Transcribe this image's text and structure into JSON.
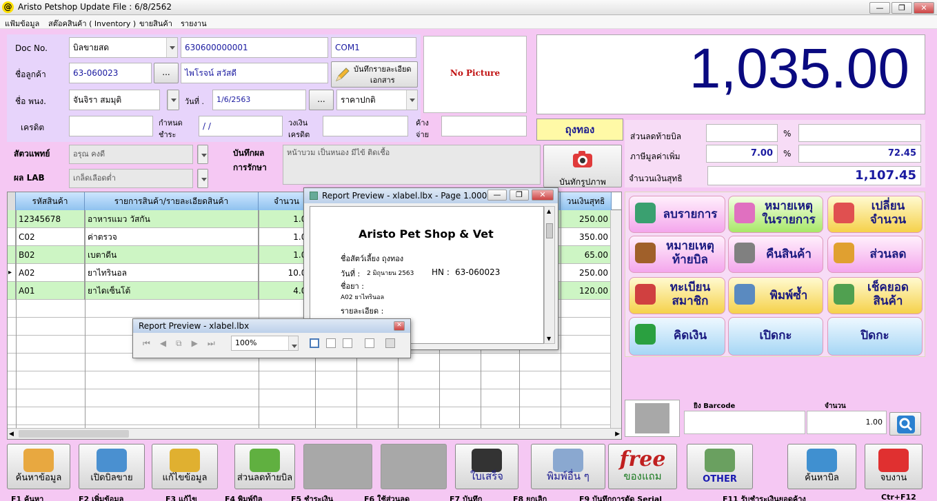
{
  "window": {
    "title": "Aristo Petshop  Update File : 6/8/2562",
    "logo": "@"
  },
  "menu": [
    "แฟ้มข้อมูล",
    "สต๊อคสินค้า ( Inventory )",
    "ขายสินค้า",
    "รายงาน"
  ],
  "form": {
    "doc_no_label": "Doc No.",
    "doc_type": "บิลขายสด",
    "doc_no": "630600000001",
    "com": "COM1",
    "customer_label": "ชื่อลูกค้า",
    "customer_code": "63-060023",
    "ellipsis": "...",
    "customer_name": "ไพโรจน์ สวัสดี",
    "save_doc_btn": [
      "บันทึกรายละเอียด",
      "เอกสาร"
    ],
    "staff_label": "ชื่อ พนง.",
    "staff": "จันจิรา สมมุติ",
    "date_label": "วันที่ .",
    "date": "1/6/2563",
    "price_type": "ราคาปกติ",
    "credit_label": "เครดิต",
    "due_label": [
      "กำหนด",
      "ชำระ"
    ],
    "due_value": "/ /",
    "limit_label": [
      "วงเงิน",
      "เครดิต"
    ],
    "owe_label": [
      "ค้าง",
      "จ่าย"
    ],
    "no_picture": "No Picture",
    "vet_label": "สัตวแพทย์",
    "vet": "อรุณ คงดี",
    "lab_label": "ผล LAB",
    "lab": "เกล็ดเลือดต่ำ",
    "treat_label": [
      "บันทึกผล",
      "การรักษา"
    ],
    "treat": "หน้าบวม เป็นหนอง มีไข้ ติดเชื้อ",
    "pet_name": "ถุงทอง",
    "photo_btn": "บันทักรูปภาพ"
  },
  "total": "1,035.00",
  "summary": {
    "discount_label": "ส่วนลดท้ายบิล",
    "percent": "%",
    "vat_label": "ภาษีมูลค่าเพิ่ม",
    "vat_rate": "7.00",
    "vat_amount": "72.45",
    "net_label": "จำนวนเงินสุทธิ",
    "net": "1,107.45"
  },
  "actions": [
    {
      "label": "ลบรายการ",
      "style": "ab-pink",
      "icon": "delete-item-icon",
      "color": "#3aa070"
    },
    {
      "label": "หมายเหตุ ในรายการ",
      "style": "ab-green",
      "icon": "comment-icon",
      "color": "#e070c0"
    },
    {
      "label": "เปลี่ยน จำนวน",
      "style": "ab-yellow",
      "icon": "swap-icon",
      "color": "#e05050"
    },
    {
      "label": "หมายเหตุ ท้ายบิล",
      "style": "ab-pink",
      "icon": "notebook-icon",
      "color": "#a0602a"
    },
    {
      "label": "คืนสินค้า",
      "style": "ab-pink",
      "icon": "return-icon",
      "color": "#808080"
    },
    {
      "label": "ส่วนลด",
      "style": "ab-pink",
      "icon": "discount-tag-icon",
      "color": "#e0a030"
    },
    {
      "label": "ทะเบียน สมาชิก",
      "style": "ab-yellow",
      "icon": "member-icon",
      "color": "#d04040"
    },
    {
      "label": "พิมพ์ซ้ำ",
      "style": "ab-yellow",
      "icon": "printer-icon",
      "color": "#5a8ac0"
    },
    {
      "label": "เช็คยอด สินค้า",
      "style": "ab-yellow",
      "icon": "clipboard-icon",
      "color": "#50a050"
    },
    {
      "label": "คิดเงิน",
      "style": "ab-blue",
      "icon": "money-icon",
      "color": "#2aa040"
    },
    {
      "label": "เปิดกะ",
      "style": "ab-blue",
      "icon": "",
      "color": ""
    },
    {
      "label": "ปิดกะ",
      "style": "ab-blue",
      "icon": "",
      "color": ""
    }
  ],
  "grid": {
    "columns": [
      "รหัสสินค้า",
      "รายการสินค้า/รายละเอียดสินค้า",
      "จำนวน",
      "วนเงินสุทธิ"
    ],
    "rows": [
      {
        "code": "12345678",
        "name": "อาหารแมว วัสกัน",
        "qty": "1.00",
        "amount": "250.00",
        "green": true,
        "marker": ""
      },
      {
        "code": "C02",
        "name": "ค่าตรวจ",
        "qty": "1.00",
        "amount": "350.00",
        "green": false,
        "marker": ""
      },
      {
        "code": "B02",
        "name": "เบตาดีน",
        "qty": "1.00",
        "amount": "65.00",
        "green": true,
        "marker": ""
      },
      {
        "code": "A02",
        "name": "ยาไทรินอล",
        "qty": "10.00",
        "amount": "250.00",
        "green": false,
        "marker": "▸"
      },
      {
        "code": "A01",
        "name": "ยาไดเซ็นโต้",
        "qty": "4.00",
        "amount": "120.00",
        "green": true,
        "marker": ""
      }
    ]
  },
  "barcode": {
    "label": "ยิง Barcode",
    "qty_label": "จำนวน",
    "qty": "1.00"
  },
  "preview": {
    "title": "Report Preview - xlabel.lbx - Page 1.000",
    "shop": "Aristo Pet Shop & Vet",
    "pet_line": "ชื่อสัตว์เลี้ยง ถุงทอง",
    "date_label": "วันที่ :",
    "date": "2 มิถุนายน 2563",
    "hn_label": "HN :",
    "hn": "63-060023",
    "drug_label": "ชื่อยา :",
    "drug": "A02 ยาไทรินอล",
    "detail_label": "รายละเอียด :"
  },
  "toolbar": {
    "title": "Report Preview - xlabel.lbx",
    "zoom": "100%"
  },
  "footer": [
    {
      "label": "ค้นหาข้อมูล",
      "icon": "search-folder-icon",
      "color": "#e8a840"
    },
    {
      "label": "เปิดบิลขาย",
      "icon": "open-bill-icon",
      "color": "#4a90d0"
    },
    {
      "label": "แก้ไขข้อมูล",
      "icon": "pencil-icon",
      "color": "#e0b030"
    },
    {
      "label": "ส่วนลดท้ายบิล",
      "icon": "sale-tag-icon",
      "color": "#60b040"
    },
    {
      "label": "",
      "icon": "",
      "color": ""
    },
    {
      "label": "",
      "icon": "",
      "color": ""
    },
    {
      "label": "ใบเสร็จ",
      "icon": "receipt-printer-icon",
      "color": "#333333"
    },
    {
      "label": "พิมพ์อื่น ๆ",
      "icon": "printer-icon",
      "color": "#8aa8d0"
    },
    {
      "label": "ของแถม",
      "icon": "free-icon",
      "color": "#c02020"
    },
    {
      "label": "OTHER",
      "icon": "cash-register-icon",
      "color": "#6aa060"
    },
    {
      "label": "ค้นหาบิล",
      "icon": "search-bill-icon",
      "color": "#4090d0"
    },
    {
      "label": "จบงาน",
      "icon": "power-icon",
      "color": "#e03030"
    }
  ],
  "free_word": "free",
  "fkeys": [
    "F1 ค้นหา",
    "F2 เพิ่มข้อมูล",
    "F3 แก้ไข",
    "F4 พิมพ์บิล",
    "F5 ชำระเงิน",
    "F6 ใช้ส่วนลด",
    "F7 บันทึก",
    "F8 ยกเลิก",
    "F9 บันทึกการตัด Serial",
    "F11 รับชำระเงินยอดค้าง",
    "Ctr+F12"
  ]
}
